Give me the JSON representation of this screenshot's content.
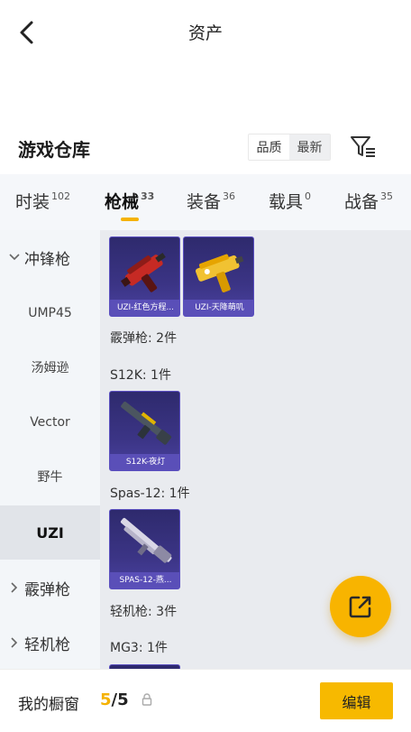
{
  "header": {
    "title": "资产"
  },
  "section": {
    "title": "游戏仓库"
  },
  "sort": {
    "options": [
      "品质",
      "最新"
    ],
    "selected": "品质"
  },
  "tabs": [
    {
      "label": "时装",
      "count": "102"
    },
    {
      "label": "枪械",
      "count": "33"
    },
    {
      "label": "装备",
      "count": "36"
    },
    {
      "label": "载具",
      "count": "0"
    },
    {
      "label": "战备",
      "count": "35"
    }
  ],
  "sidebar": {
    "items": [
      {
        "label": "冲锋枪",
        "type": "group-expanded"
      },
      {
        "label": "UMP45",
        "type": "sub"
      },
      {
        "label": "汤姆逊",
        "type": "sub"
      },
      {
        "label": "Vector",
        "type": "sub"
      },
      {
        "label": "野牛",
        "type": "sub"
      },
      {
        "label": "UZI",
        "type": "sub-selected"
      },
      {
        "label": "霰弹枪",
        "type": "group"
      },
      {
        "label": "轻机枪",
        "type": "group"
      }
    ]
  },
  "content": {
    "cards": [
      {
        "label": "UZI-红色方程...",
        "art": "red-uzi"
      },
      {
        "label": "UZI-天降萌叽",
        "art": "gold-uzi"
      },
      {
        "label": "S12K-夜灯",
        "art": "s12k"
      },
      {
        "label": "SPAS-12-燕...",
        "art": "spas"
      }
    ],
    "groups": [
      "霰弹枪: 2件",
      "S12K: 1件",
      "Spas-12: 1件",
      "轻机枪: 3件",
      "MG3: 1件"
    ]
  },
  "bottom": {
    "label": "我的橱窗",
    "current": "5",
    "separator": "/",
    "total": "5",
    "edit_label": "编辑"
  },
  "colors": {
    "accent": "#f7b900",
    "card_bg": "#3b3485",
    "card_label": "#5a4fb8"
  },
  "icons": {
    "back": "chevron-left-icon",
    "filter": "filter-list-icon",
    "lock": "lock-icon",
    "share": "share-external-icon"
  }
}
